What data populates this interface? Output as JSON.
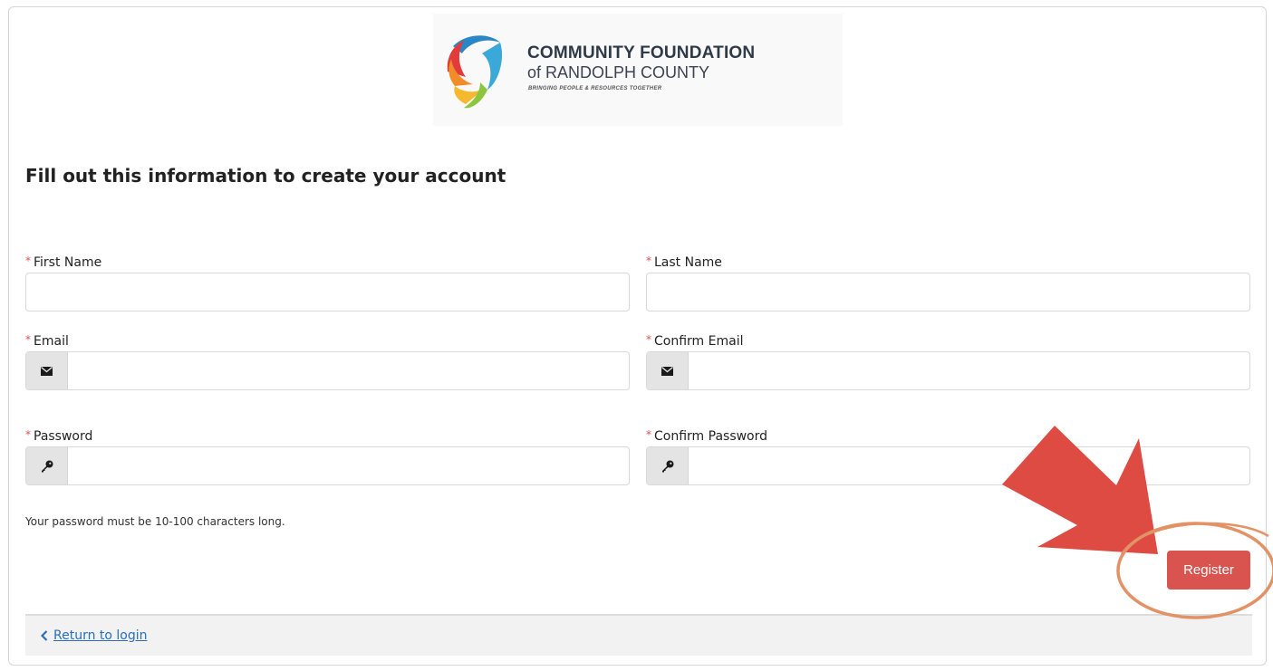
{
  "logo": {
    "line1": "COMMUNITY FOUNDATION",
    "line2": "of RANDOLPH COUNTY",
    "tagline": "BRINGING PEOPLE & RESOURCES TOGETHER"
  },
  "form": {
    "heading": "Fill out this information to create your account",
    "required_marker": "*",
    "first_name": {
      "label": "First Name",
      "value": ""
    },
    "last_name": {
      "label": "Last Name",
      "value": ""
    },
    "email": {
      "label": "Email",
      "value": "",
      "icon": "envelope-icon"
    },
    "confirm_email": {
      "label": "Confirm Email",
      "value": "",
      "icon": "envelope-icon"
    },
    "password": {
      "label": "Password",
      "value": "",
      "icon": "key-icon"
    },
    "confirm_password": {
      "label": "Confirm Password",
      "value": "",
      "icon": "key-icon"
    },
    "password_help": "Your password must be 10-100 characters long.",
    "register_label": "Register"
  },
  "footer": {
    "return_label": "Return to login",
    "return_icon": "chevron-left-icon"
  },
  "colors": {
    "accent_red": "#d9534f",
    "link_blue": "#2a6ebb",
    "annotation_arrow": "#dd4b42",
    "annotation_circle": "#e39265"
  }
}
